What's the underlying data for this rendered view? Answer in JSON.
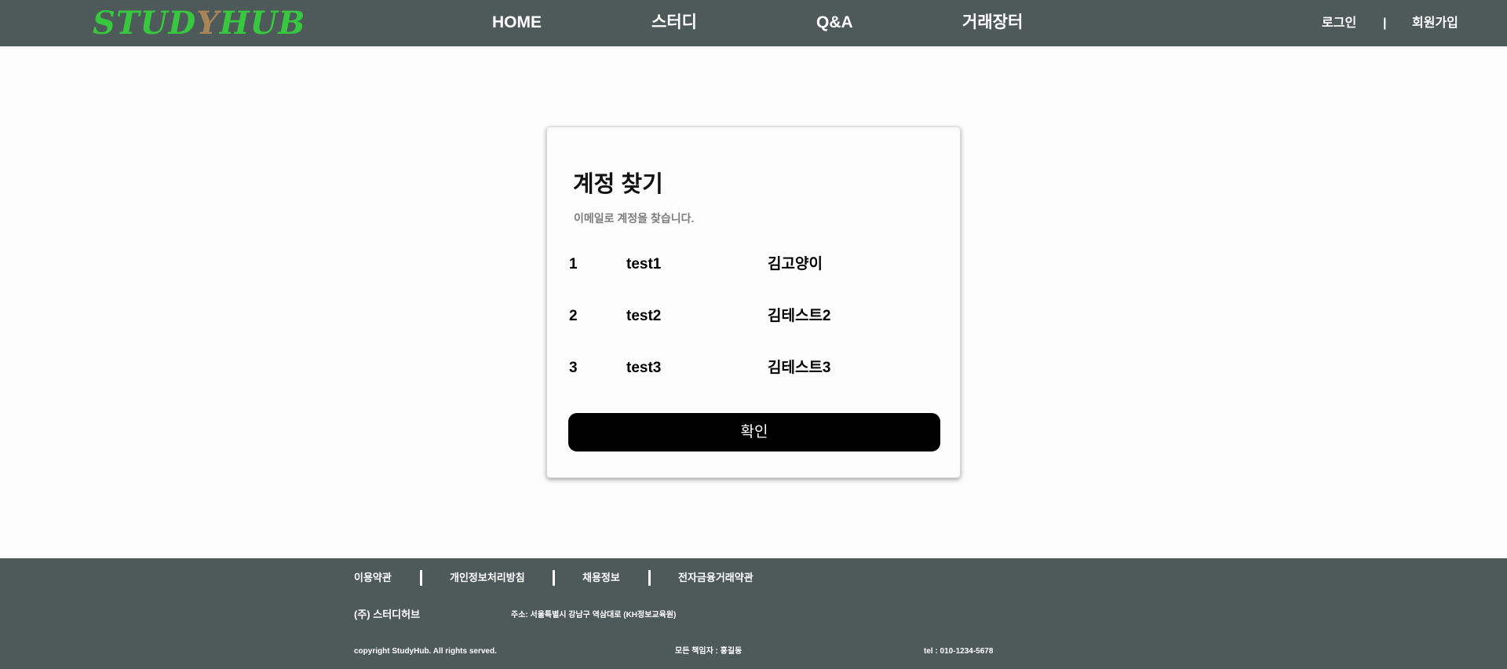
{
  "header": {
    "logo": {
      "part1": "STUD",
      "part2": "Y",
      "part3": "HUB"
    },
    "nav": [
      "HOME",
      "스터디",
      "Q&A",
      "거래장터"
    ],
    "login": "로그인",
    "divider": "|",
    "signup": "회원가입"
  },
  "card": {
    "title": "계정 찾기",
    "subtitle": "이메일로 계정을 찾습니다.",
    "rows": [
      {
        "no": "1",
        "id": "test1",
        "name": "김고양이"
      },
      {
        "no": "2",
        "id": "test2",
        "name": "김테스트2"
      },
      {
        "no": "3",
        "id": "test3",
        "name": "김테스트3"
      }
    ],
    "confirm_label": "확인"
  },
  "footer": {
    "links": [
      "이용약관",
      "개인정보처리방침",
      "채용정보",
      "전자금융거래약관"
    ],
    "company": "(주) 스터디허브",
    "address": "주소: 서울특별시 강남구 역삼대로 (KH정보교육원)",
    "copyright": "copyright StudyHub. All rights served.",
    "manager": "모든 책임자 : 홍길동",
    "tel": "tel : 010-1234-5678"
  },
  "colors": {
    "header_bg": "#4e5a59",
    "footer_bg": "#4e5a59",
    "logo_green": "#37c840",
    "logo_brown": "#a8865a",
    "button_bg": "#000000"
  }
}
